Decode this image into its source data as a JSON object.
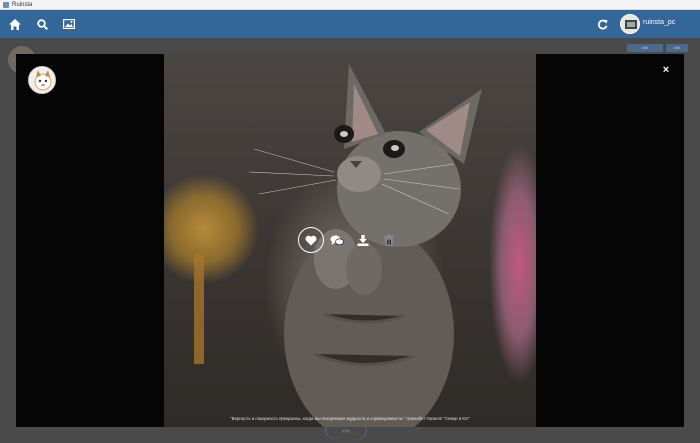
{
  "window": {
    "title": "Ruinsta"
  },
  "topbar": {
    "nav": [
      {
        "icon": "home-icon"
      },
      {
        "icon": "search-icon"
      },
      {
        "icon": "photo-icon"
      }
    ],
    "refresh_icon": "refresh-icon",
    "username": "ruinsta_pc"
  },
  "feed": {
    "buttons": [
      "###",
      "###"
    ],
    "more_label": "###"
  },
  "modal": {
    "close_label": "×",
    "actions": [
      "heart-icon",
      "comments-icon",
      "download-icon",
      "trash-icon"
    ],
    "caption": "\"Верность и покорность прекрасны, когда мы покоряемся мудрости и справедливости.\" Элизабет Гаскелл \"Север и Юг\""
  },
  "colors": {
    "topbar": "#336699",
    "modal_bg": "#050505",
    "overlay": "#3d3d3d"
  }
}
